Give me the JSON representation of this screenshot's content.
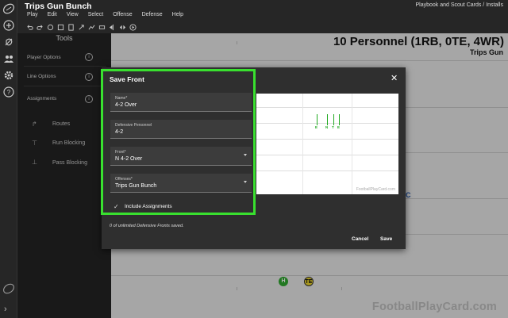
{
  "app": {
    "title": "Trips Gun Bunch",
    "breadcrumb": "Playbook and Scout Cards  /  Installs"
  },
  "menu": [
    "Play",
    "Edit",
    "View",
    "Select",
    "Offense",
    "Defense",
    "Help"
  ],
  "tools": {
    "title": "Tools",
    "items": [
      "Player Options",
      "Line Options",
      "Assignments"
    ],
    "assignments": [
      "Routes",
      "Run Blocking",
      "Pass Blocking"
    ],
    "info_symbol": "i"
  },
  "field": {
    "formation_title": "10 Personnel (1RB, 0TE, 4WR)",
    "formation_subtitle": "Trips Gun",
    "watermark": "FootballPlayCard.com",
    "visible_letter": "C",
    "players": [
      {
        "label": "H",
        "color": "#2ea62e",
        "text_color": "#ffffff"
      },
      {
        "label": "TE",
        "color": "#e8d22b",
        "text_color": "#111111"
      }
    ]
  },
  "modal": {
    "title": "Save Front",
    "close_symbol": "✕",
    "fields": {
      "name": {
        "label": "Name*",
        "value": "4-2 Over"
      },
      "personnel": {
        "label": "Defensive Personnel",
        "value": "4-2"
      },
      "front": {
        "label": "Front*",
        "value": "N 4-2 Over"
      },
      "offenses": {
        "label": "Offenses*",
        "value": "Trips Gun Bunch"
      }
    },
    "include_assignments": {
      "label": "Include Assignments",
      "checked": true,
      "check_symbol": "✓"
    },
    "saved_note": "0 of unlimited Defensive Fronts saved.",
    "cancel_label": "Cancel",
    "save_label": "Save",
    "preview": {
      "watermark": "FootballPlayCard.com",
      "players": [
        "E",
        "N",
        "T",
        "E"
      ]
    }
  },
  "colors": {
    "highlight": "#39e02f",
    "accent_green": "#2ea62e"
  }
}
